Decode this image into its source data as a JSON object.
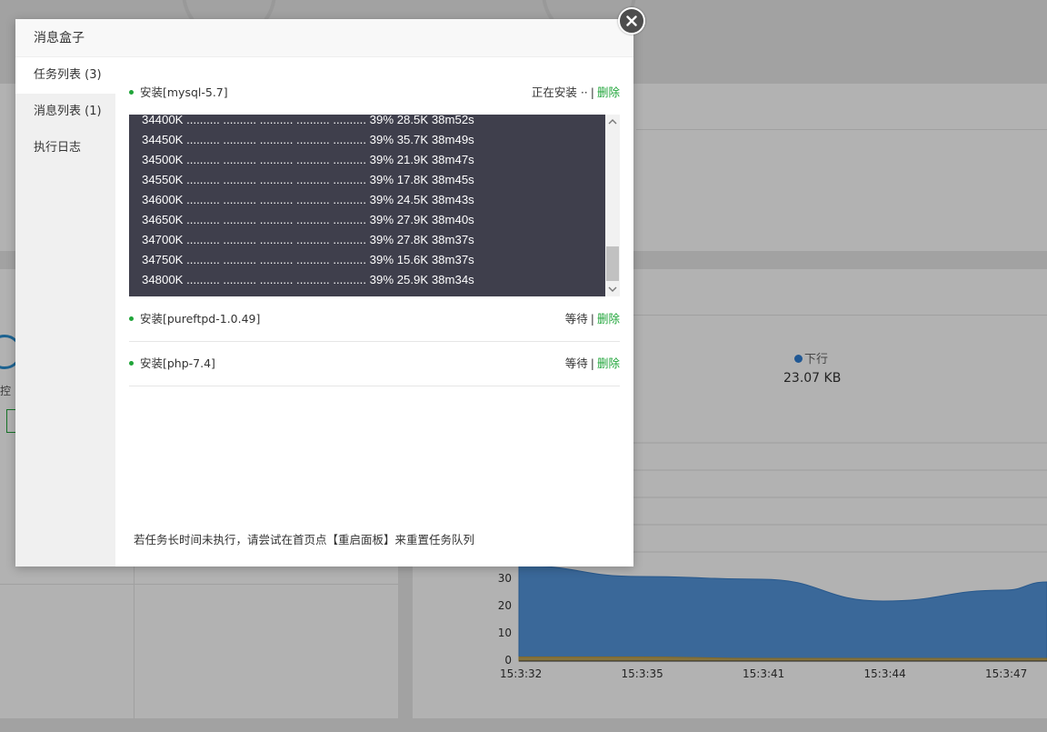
{
  "modal": {
    "title": "消息盒子",
    "sidebar": [
      {
        "label": "任务列表 (3)",
        "active": true
      },
      {
        "label": "消息列表 (1)",
        "active": false
      },
      {
        "label": "执行日志",
        "active": false
      }
    ],
    "tasks": [
      {
        "name": "安装[mysql-5.7]",
        "status": "正在安装 ··",
        "action": "删除"
      },
      {
        "name": "安装[pureftpd-1.0.49]",
        "status": "等待",
        "action": "删除"
      },
      {
        "name": "安装[php-7.4]",
        "status": "等待",
        "action": "删除"
      }
    ],
    "console_lines": [
      "34400K .......... .......... .......... .......... .......... 39% 28.5K 38m52s",
      "34450K .......... .......... .......... .......... .......... 39% 35.7K 38m49s",
      "34500K .......... .......... .......... .......... .......... 39% 21.9K 38m47s",
      "34550K .......... .......... .......... .......... .......... 39% 17.8K 38m45s",
      "34600K .......... .......... .......... .......... .......... 39% 24.5K 38m43s",
      "34650K .......... .......... .......... .......... .......... 39% 27.9K 38m40s",
      "34700K .......... .......... .......... .......... .......... 39% 27.8K 38m37s",
      "34750K .......... .......... .......... .......... .......... 39% 15.6K 38m37s",
      "34800K .......... .......... .......... .......... .......... 39% 25.9K 38m34s"
    ],
    "hint": "若任务长时间未执行，请尝试在首页点【重启面板】来重置任务队列"
  },
  "background": {
    "side_text": "控",
    "legend_label": "下行",
    "legend_value": "23.07 KB",
    "legend_color": "#2f7fd4"
  },
  "chart_data": {
    "type": "area",
    "x": [
      "15:3:32",
      "15:3:35",
      "15:3:41",
      "15:3:44",
      "15:3:47"
    ],
    "y_ticks": [
      0,
      10,
      20,
      30
    ],
    "series": [
      {
        "name": "下行",
        "color": "#4a90d9",
        "values": [
          35,
          31,
          30,
          22,
          26
        ]
      },
      {
        "color": "#c9a64a",
        "values": [
          1.5,
          1.5,
          1,
          1,
          1
        ]
      }
    ]
  }
}
